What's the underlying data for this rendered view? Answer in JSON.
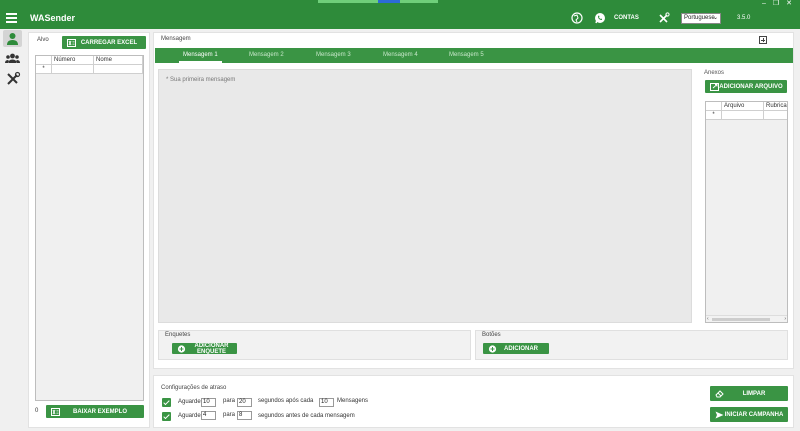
{
  "window": {
    "minimize": "–",
    "restore": "❐",
    "close": "✕"
  },
  "app": {
    "name": "WASender",
    "version": "3.5.0"
  },
  "header": {
    "contas_label": "CONTAS",
    "language": "Portuguese"
  },
  "left": {
    "alvo_label": "Alvo",
    "load_excel_label": "CARREGAR EXCEL",
    "columns": [
      "Número",
      "Nome"
    ],
    "row_marker": "*",
    "count": "0",
    "download_example_label": "BAIXAR EXEMPLO"
  },
  "message": {
    "title": "Mensagem",
    "tabs": [
      "Mensagem 1",
      "Mensagem 2",
      "Mensagem 3",
      "Mensagem 4",
      "Mensagem 5"
    ],
    "placeholder": "* Sua primeira mensagem",
    "anexos_label": "Anexos",
    "add_file_label": "ADICIONAR ARQUIVO",
    "attach_columns": [
      "Arquivo",
      "Rubrica"
    ],
    "attach_row_marker": "*",
    "enquetes_label": "Enquetes",
    "add_poll_label": "ADICIONAR ENQUETE",
    "botoes_label": "Botões",
    "add_button_label": "ADICIONAR"
  },
  "delay": {
    "title": "Configurações de atraso",
    "row1": {
      "aguarde": "Aguarde",
      "min": "10",
      "para": "para",
      "max": "20",
      "suffix": "segundos após cada",
      "count": "10",
      "unit": "Mensagens"
    },
    "row2": {
      "aguarde": "Aguarde",
      "min": "4",
      "para": "para",
      "max": "8",
      "suffix": "segundos antes de cada mensagem"
    },
    "clear_label": "LIMPAR",
    "start_label": "INICIAR CAMPANHA"
  },
  "colors": {
    "primary": "#2e8b3a",
    "button": "#3a9444"
  }
}
